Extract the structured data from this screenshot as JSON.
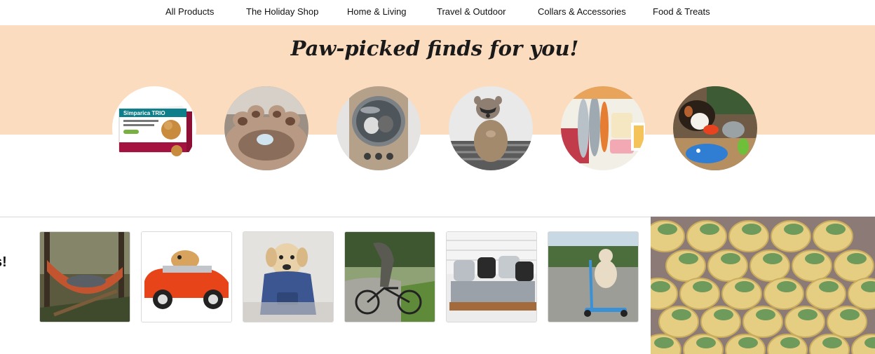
{
  "nav": {
    "items": [
      {
        "label": "All Products"
      },
      {
        "label": "The Holiday Shop"
      },
      {
        "label": "Home & Living"
      },
      {
        "label": "Travel & Outdoor"
      },
      {
        "label": "Collars & Accessories"
      },
      {
        "label": "Food & Treats"
      }
    ]
  },
  "hero": {
    "title": "Paw-picked finds for you!",
    "band_color": "#fbdcbf"
  },
  "categories": [
    {
      "icon": "medicine-box-image",
      "product_text": "Simparica TRIO"
    },
    {
      "icon": "plush-paw-bed-image"
    },
    {
      "icon": "cat-backpack-carrier-image"
    },
    {
      "icon": "raccoon-costume-image"
    },
    {
      "icon": "fish-and-meat-food-image"
    },
    {
      "icon": "dog-with-toys-image"
    }
  ],
  "section": {
    "heading_fragment": "s!"
  },
  "products": [
    {
      "icon": "hammock-image"
    },
    {
      "icon": "toy-car-hamster-image"
    },
    {
      "icon": "dog-hoodie-image"
    },
    {
      "icon": "bicycle-sculpture-image"
    },
    {
      "icon": "pallet-pet-bed-image"
    },
    {
      "icon": "dog-on-scooter-image"
    }
  ],
  "feature": {
    "icon": "pumpkin-treats-image"
  }
}
